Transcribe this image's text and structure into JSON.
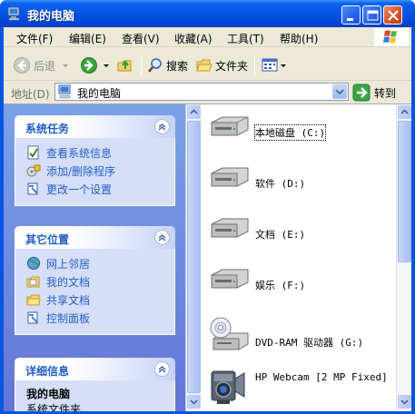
{
  "window": {
    "title": "我的电脑"
  },
  "menu": [
    "文件(F)",
    "编辑(E)",
    "查看(V)",
    "收藏(A)",
    "工具(T)",
    "帮助(H)"
  ],
  "toolbar": {
    "back": "后退",
    "search": "搜索",
    "folders": "文件夹"
  },
  "address": {
    "label": "地址(D)",
    "value": "我的电脑",
    "go": "转到"
  },
  "taskpane": {
    "system_tasks": {
      "title": "系统任务",
      "items": [
        "查看系统信息",
        "添加/删除程序",
        "更改一个设置"
      ]
    },
    "other_places": {
      "title": "其它位置",
      "items": [
        "网上邻居",
        "我的文档",
        "共享文档",
        "控制面板"
      ]
    },
    "details": {
      "title": "详细信息",
      "name": "我的电脑",
      "type": "系统文件夹"
    }
  },
  "files": [
    {
      "name": "本地磁盘 (C:)",
      "icon": "hard-drive-icon"
    },
    {
      "name": "软件 (D:)",
      "icon": "hard-drive-icon"
    },
    {
      "name": "文档 (E:)",
      "icon": "hard-drive-icon"
    },
    {
      "name": "娱乐 (F:)",
      "icon": "hard-drive-icon"
    },
    {
      "name": "DVD-RAM 驱动器 (G:)",
      "icon": "dvd-drive-icon"
    },
    {
      "name": "HP Webcam [2 MP Fixed]",
      "icon": "webcam-icon"
    }
  ],
  "colors": {
    "title_bar": "#0554e3",
    "task_link": "#215dc6",
    "task_pane": "#7ba2e7",
    "frame": "#ece9d8"
  }
}
